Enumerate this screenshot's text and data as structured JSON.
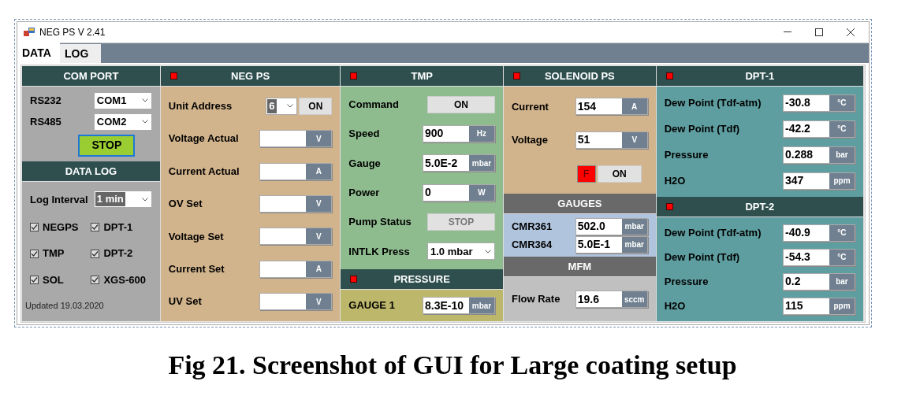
{
  "window": {
    "title": "NEG PS V 2.41"
  },
  "tabs": [
    {
      "label": "DATA",
      "selected": true
    },
    {
      "label": "LOG",
      "selected": false
    }
  ],
  "columns": [
    {
      "sections": [
        {
          "title": "COM PORT",
          "kind": "dark",
          "indicator": false,
          "color": "#a9a9a9",
          "rows": [
            {
              "kind": "select",
              "label": "RS232",
              "value": "COM1",
              "highlighted": false
            },
            {
              "kind": "select",
              "label": "RS485",
              "value": "COM2",
              "highlighted": false
            },
            {
              "kind": "action",
              "button": "STOP",
              "focused": true
            }
          ]
        },
        {
          "title": "DATA LOG",
          "kind": "dark",
          "indicator": false,
          "color": "#a9a9a9",
          "rows": [
            {
              "kind": "select",
              "label": "Log Interval",
              "value": "1 min",
              "highlighted": true
            },
            {
              "kind": "checks",
              "items": [
                {
                  "label": "NEGPS",
                  "checked": true
                },
                {
                  "label": "DPT-1",
                  "checked": true
                },
                {
                  "label": "TMP",
                  "checked": true
                },
                {
                  "label": "DPT-2",
                  "checked": true
                },
                {
                  "label": "SOL",
                  "checked": true
                },
                {
                  "label": "XGS-600",
                  "checked": true
                }
              ]
            },
            {
              "kind": "note",
              "text": "Updated 19.03.2020"
            }
          ]
        }
      ]
    },
    {
      "sections": [
        {
          "title": "NEG PS",
          "kind": "dark",
          "indicator": true,
          "color": "#d2b48c",
          "rows": [
            {
              "kind": "select_button",
              "label": "Unit Address",
              "value": "6",
              "highlighted": true,
              "button": "ON"
            },
            {
              "kind": "field",
              "label": "Voltage Actual",
              "unit": "V"
            },
            {
              "kind": "field",
              "label": "Current Actual",
              "unit": "A"
            },
            {
              "kind": "field",
              "label": "OV Set",
              "unit": "V"
            },
            {
              "kind": "field",
              "label": "Voltage Set",
              "unit": "V"
            },
            {
              "kind": "field",
              "label": "Current Set",
              "unit": "A"
            },
            {
              "kind": "field",
              "label": "UV Set",
              "unit": "V"
            }
          ]
        }
      ]
    },
    {
      "sections": [
        {
          "title": "TMP",
          "kind": "dark",
          "indicator": true,
          "color": "#8fbc8f",
          "rows": [
            {
              "kind": "button",
              "label": "Command",
              "button": "ON",
              "disabled": false
            },
            {
              "kind": "field",
              "label": "Speed",
              "value": "900",
              "unit": "Hz"
            },
            {
              "kind": "field",
              "label": "Gauge",
              "value": "5.0E-2",
              "unit": "mbar"
            },
            {
              "kind": "field",
              "label": "Power",
              "value": "0",
              "unit": "W"
            },
            {
              "kind": "button",
              "label": "Pump Status",
              "button": "STOP",
              "disabled": true
            },
            {
              "kind": "select",
              "label": "INTLK Press",
              "value": "1.0 mbar",
              "highlighted": false
            }
          ]
        },
        {
          "title": "PRESSURE",
          "kind": "dark",
          "indicator": true,
          "color": "#bdb76b",
          "rows": [
            {
              "kind": "field",
              "label": "GAUGE 1",
              "value": "8.3E-10",
              "unit": "mbar"
            }
          ]
        }
      ]
    },
    {
      "sections": [
        {
          "title": "SOLENOID PS",
          "kind": "dark",
          "indicator": true,
          "color": "#d2b48c",
          "rows": [
            {
              "kind": "field",
              "label": "Current",
              "value": "154",
              "unit": "A"
            },
            {
              "kind": "field",
              "label": "Voltage",
              "value": "51",
              "unit": "V"
            },
            {
              "kind": "fault",
              "flag": "F",
              "button": "ON"
            }
          ]
        },
        {
          "title": "GAUGES",
          "kind": "grey",
          "indicator": false,
          "color": "#b0c4de",
          "rows": [
            {
              "kind": "field",
              "label": "CMR361",
              "value": "502.0",
              "unit": "mbar"
            },
            {
              "kind": "field",
              "label": "CMR364",
              "value": "5.0E-1",
              "unit": "mbar"
            }
          ]
        },
        {
          "title": "MFM",
          "kind": "grey",
          "indicator": false,
          "color": "#c0c0c0",
          "rows": [
            {
              "kind": "field",
              "label": "Flow Rate",
              "value": "19.6",
              "unit": "sccm"
            }
          ]
        }
      ]
    },
    {
      "sections": [
        {
          "title": "DPT-1",
          "kind": "dark",
          "indicator": true,
          "color": "#5f9ea0",
          "rows": [
            {
              "kind": "field",
              "label": "Dew Point (Tdf-atm)",
              "value": "-30.8",
              "unit": "°C"
            },
            {
              "kind": "field",
              "label": "Dew Point (Tdf)",
              "value": "-42.2",
              "unit": "°C"
            },
            {
              "kind": "field",
              "label": "Pressure",
              "value": "0.288",
              "unit": "bar"
            },
            {
              "kind": "field",
              "label": "H2O",
              "value": "347",
              "unit": "ppm"
            }
          ]
        },
        {
          "title": "DPT-2",
          "kind": "dark",
          "indicator": true,
          "color": "#5f9ea0",
          "rows": [
            {
              "kind": "field",
              "label": "Dew Point (Tdf-atm)",
              "value": "-40.9",
              "unit": "°C"
            },
            {
              "kind": "field",
              "label": "Dew Point (Tdf)",
              "value": "-54.3",
              "unit": "°C"
            },
            {
              "kind": "field",
              "label": "Pressure",
              "value": "0.2",
              "unit": "bar"
            },
            {
              "kind": "field",
              "label": "H2O",
              "value": "115",
              "unit": "ppm"
            }
          ]
        }
      ]
    }
  ],
  "caption": "Fig 21. Screenshot of GUI for Large coating setup"
}
